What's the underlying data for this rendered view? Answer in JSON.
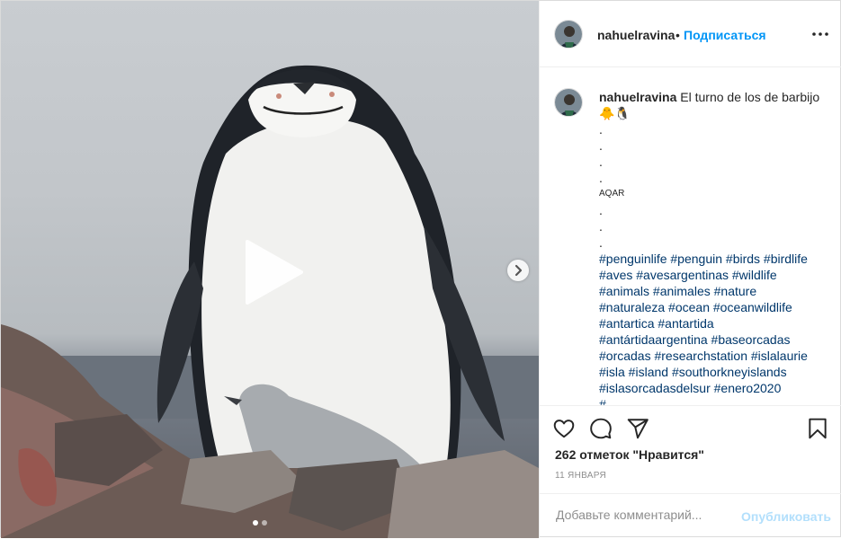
{
  "post": {
    "username": "nahuelravina",
    "header_separator": "•",
    "follow_label": "Подписаться",
    "caption": {
      "username": "nahuelravina",
      "title": "El turno de los de barbijo 🐥🐧",
      "lines": [
        ".",
        ".",
        ".",
        ".",
        "AQAR",
        ".",
        ".",
        "."
      ],
      "hashtag_lines": [
        "#penguinlife #penguin #birds #birdlife",
        "#aves #avesargentinas #wildlife",
        "#animals #animales #nature",
        "#naturaleza #ocean #oceanwildlife",
        "#antartica #antartida",
        "#antártidaargentina #baseorcadas",
        "#orcadas #researchstation #islalaurie",
        "#isla #island #southorkneyislands",
        "#islasorcadasdelsur #enero2020",
        "#..."
      ]
    },
    "likes_text": "262 отметок \"Нравится\"",
    "date_text": "11 ЯНВАРЯ",
    "comment_placeholder": "Добавьте комментарий...",
    "publish_label": "Опубликовать",
    "carousel": {
      "total_slides": 2,
      "active_slide": 1
    }
  },
  "icons": {
    "play": "play-icon",
    "next": "chevron-right-icon",
    "more": "more-options-icon",
    "like": "heart-icon",
    "comment": "comment-icon",
    "share": "send-icon",
    "save": "bookmark-icon"
  },
  "colors": {
    "link_blue": "#0095f6",
    "hashtag": "#00376b",
    "publish_disabled": "#b2dffc",
    "muted": "#8e8e8e"
  }
}
